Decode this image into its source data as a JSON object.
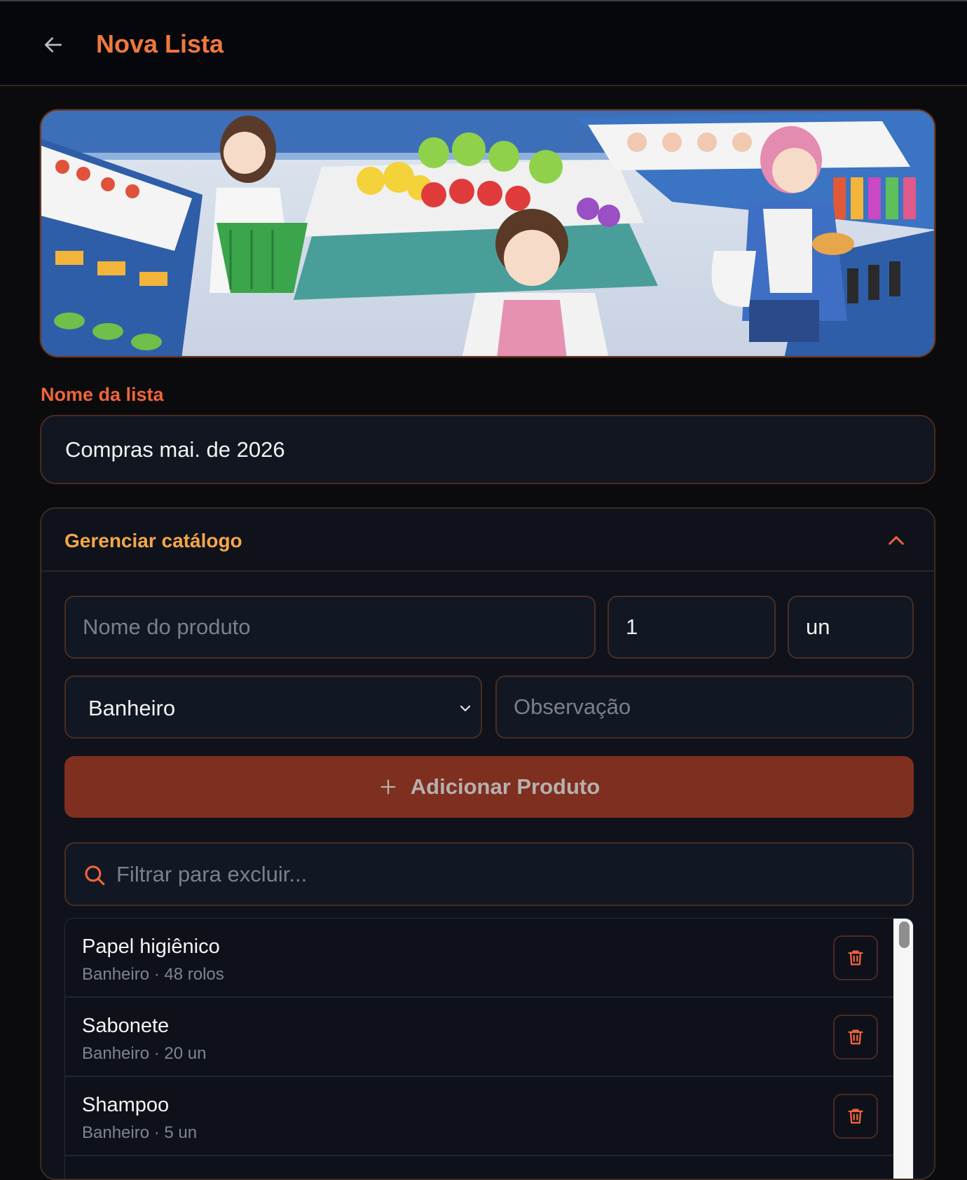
{
  "header": {
    "title": "Nova Lista",
    "back_icon": "arrow-left-icon"
  },
  "banner": {
    "description_icon": "supermarket-banner"
  },
  "list_name": {
    "label": "Nome da lista",
    "value": "Compras mai. de 2026"
  },
  "catalog": {
    "title": "Gerenciar catálogo",
    "product_name_placeholder": "Nome do produto",
    "quantity_value": "1",
    "unit_value": "un",
    "category_selected": "Banheiro",
    "note_placeholder": "Observação",
    "add_button_label": "Adicionar Produto",
    "filter_placeholder": "Filtrar para excluir...",
    "items": [
      {
        "name": "Papel higiênico",
        "meta": "Banheiro · 48 rolos"
      },
      {
        "name": "Sabonete",
        "meta": "Banheiro · 20 un"
      },
      {
        "name": "Shampoo",
        "meta": "Banheiro · 5 un"
      }
    ]
  },
  "colors": {
    "accent": "#f0783c",
    "label": "#f0643c",
    "catalog_title": "#f4a64a",
    "button": "#7e2f1f"
  }
}
